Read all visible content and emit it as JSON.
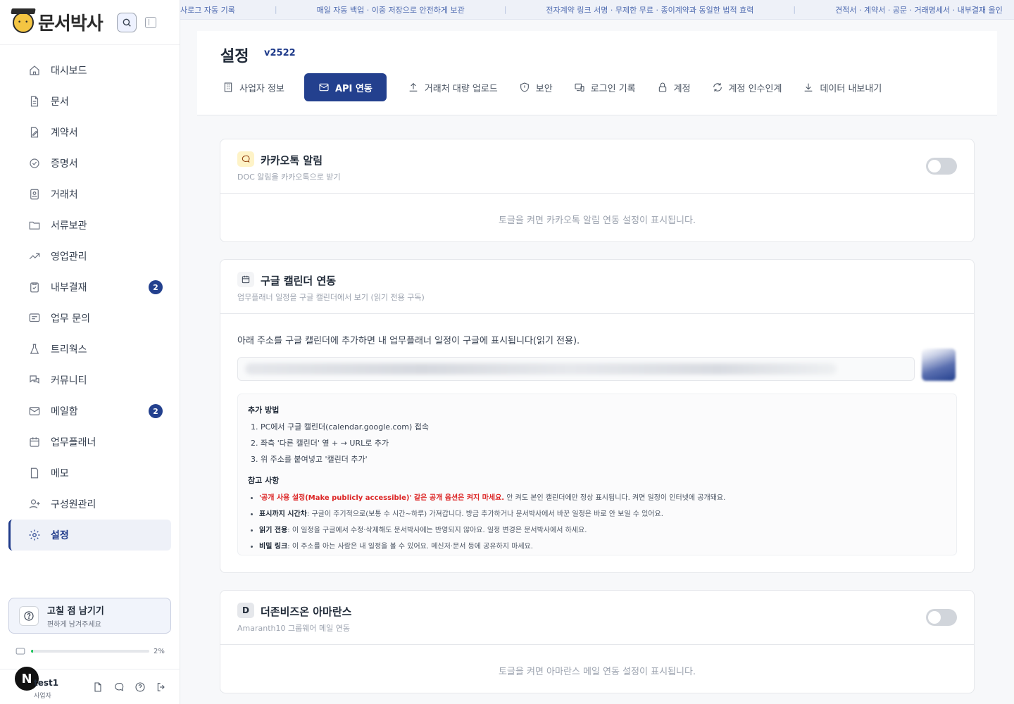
{
  "brand": {
    "name": "문서박사"
  },
  "nav": [
    {
      "label": "대시보드",
      "icon": "home-icon"
    },
    {
      "label": "문서",
      "icon": "document-icon"
    },
    {
      "label": "계약서",
      "icon": "contract-icon"
    },
    {
      "label": "증명서",
      "icon": "certificate-icon"
    },
    {
      "label": "거래처",
      "icon": "contact-card-icon"
    },
    {
      "label": "서류보관",
      "icon": "folder-icon"
    },
    {
      "label": "영업관리",
      "icon": "trend-icon"
    },
    {
      "label": "내부결재",
      "icon": "clipboard-check-icon",
      "badge": "2"
    },
    {
      "label": "업무 문의",
      "icon": "message-lines-icon"
    },
    {
      "label": "트리웍스",
      "icon": "flask-icon"
    },
    {
      "label": "커뮤니티",
      "icon": "chat-bubbles-icon"
    },
    {
      "label": "메일함",
      "icon": "mail-icon",
      "badge": "2"
    },
    {
      "label": "업무플래너",
      "icon": "calendar-icon"
    },
    {
      "label": "메모",
      "icon": "note-icon"
    },
    {
      "label": "구성원관리",
      "icon": "user-add-icon"
    },
    {
      "label": "설정",
      "icon": "gear-icon",
      "active": true
    }
  ],
  "feedback": {
    "title": "고칠 점 남기기",
    "subtitle": "편하게 남겨주세요"
  },
  "storage": {
    "percent_label": "2%",
    "fill_fraction": 0.02
  },
  "user": {
    "avatar_letter": "N",
    "name": "test1",
    "role": "사업자"
  },
  "ticker": [
    "사로그 자동 기록",
    "매일 자동 백업 · 이중 저장으로 안전하게 보관",
    "전자계약 링크 서명 · 무제한 무료 · 종이계약과 동일한 법적 효력",
    "견적서 · 계약서 · 공문 · 거래명세서 · 내부결재 올인"
  ],
  "header": {
    "title": "설정",
    "version": "v2522"
  },
  "tabs": [
    {
      "label": "사업자 정보",
      "icon": "building-icon"
    },
    {
      "label": "API 연동",
      "icon": "mail-icon",
      "active": true
    },
    {
      "label": "거래처 대량 업로드",
      "icon": "upload-icon"
    },
    {
      "label": "보안",
      "icon": "shield-icon"
    },
    {
      "label": "로그인 기록",
      "icon": "devices-icon"
    },
    {
      "label": "계정",
      "icon": "lock-icon"
    },
    {
      "label": "계정 인수인계",
      "icon": "refresh-icon"
    },
    {
      "label": "데이터 내보내기",
      "icon": "download-icon"
    }
  ],
  "kakao": {
    "title": "카카오톡 알림",
    "subtitle": "DOC 알림을 카카오톡으로 받기",
    "placeholder": "토글을 켜면 카카오톡 알림 연동 설정이 표시됩니다.",
    "chip_color": "#fde68a",
    "enabled": false
  },
  "gcal": {
    "title": "구글 캘린더 연동",
    "subtitle": "업무플래너 일정을 구글 캘린더에서 보기 (읽기 전용 구독)",
    "description": "아래 주소를 구글 캘린더에 추가하면 내 업무플래너 일정이 구글에 표시됩니다(읽기 전용).",
    "how_title": "추가 방법",
    "steps": [
      "PC에서 구글 캘린더(calendar.google.com) 접속",
      "좌측 '다른 캘린더' 옆 + → URL로 추가",
      "위 주소를 붙여넣고 '캘린더 추가'"
    ],
    "notes_title": "참고 사항",
    "notes": [
      {
        "strong": "'공개 사용 설정(Make publicly accessible)' 같은 공개 옵션은 켜지 마세요.",
        "text": " 안 켜도 본인 캘린더에만 정상 표시됩니다. 켜면 일정이 인터넷에 공개돼요."
      },
      {
        "strong": "표시까지 시간차",
        "text": ": 구글이 주기적으로(보통 수 시간~하루) 가져갑니다. 방금 추가하거나 문서박사에서 바꾼 일정은 바로 안 보일 수 있어요."
      },
      {
        "strong": "읽기 전용",
        "text": ": 이 일정을 구글에서 수정·삭제해도 문서박사에는 반영되지 않아요. 일정 변경은 문서박사에서 하세요."
      },
      {
        "strong": "비밀 링크",
        "text": ": 이 주소를 아는 사람은 내 일정을 볼 수 있어요. 메신저·문서 등에 공유하지 마세요."
      }
    ]
  },
  "amaranth": {
    "chip_letter": "D",
    "title": "더존비즈온 아마란스",
    "subtitle": "Amaranth10 그룹웨어 메일 연동",
    "placeholder": "토글을 켜면 아마란스 메일 연동 설정이 표시됩니다.",
    "enabled": false
  }
}
